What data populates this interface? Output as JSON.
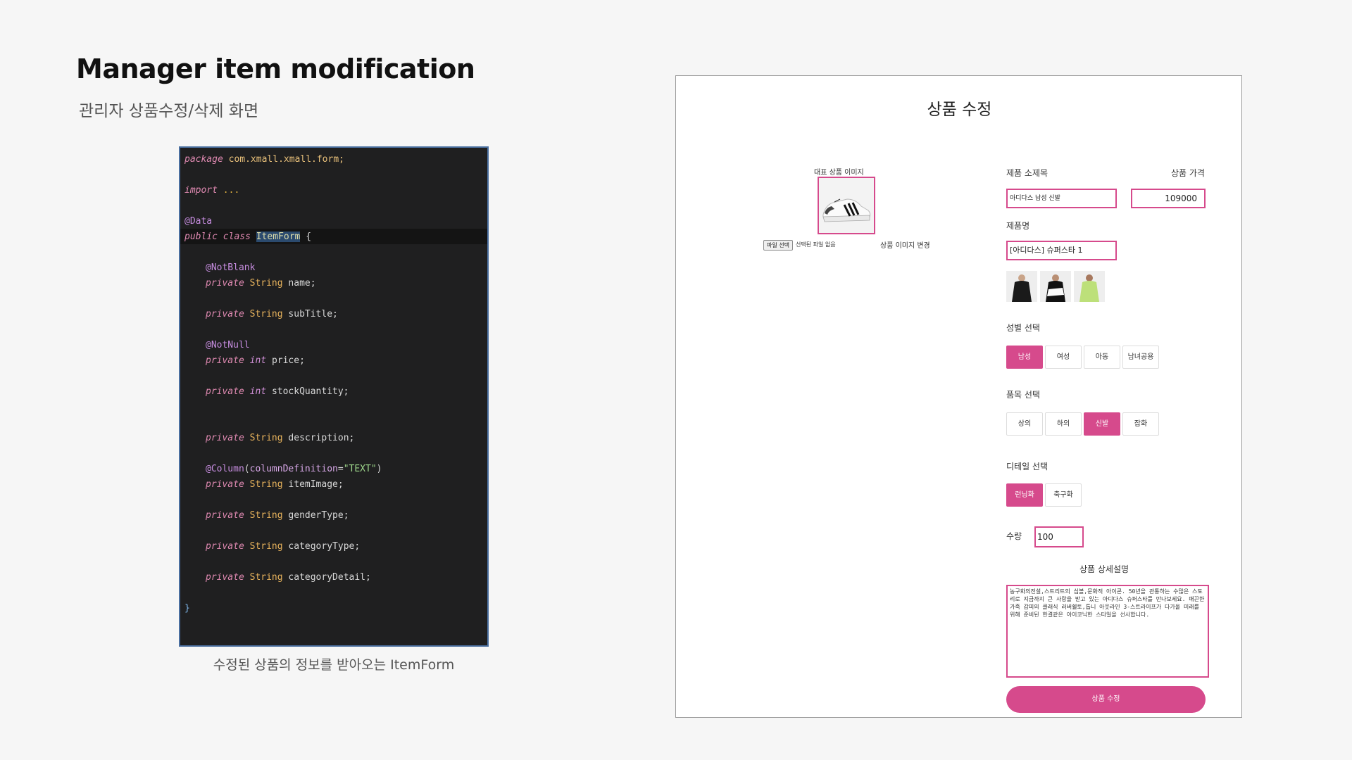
{
  "slide": {
    "title": "Manager item modification",
    "subtitle": "관리자 상품수정/삭제 화면",
    "code_caption": "수정된 상품의 정보를 받아오는 ItemForm"
  },
  "code": {
    "package_kw": "package",
    "package_name": "com.xmall.xmall.form;",
    "import_kw": "import",
    "import_rest": " ...",
    "data_annotation": "@Data",
    "public_kw": "public",
    "class_kw": "class",
    "class_name": "ItemForm",
    "open_brace": " {",
    "notblank": "@NotBlank",
    "notnull": "@NotNull",
    "column_anno": "@Column",
    "column_attr": "columnDefinition",
    "column_value": "\"TEXT\"",
    "private_kw": "private",
    "string_type": "String",
    "int_type": "int",
    "field_name": "name;",
    "field_subtitle": "subTitle;",
    "field_price": "price;",
    "field_stock": "stockQuantity;",
    "field_description": "description;",
    "field_itemimage": "itemImage;",
    "field_gender": "genderType;",
    "field_category": "categoryType;",
    "field_detail": "categoryDetail;",
    "close_brace": "}"
  },
  "form": {
    "title": "상품 수정",
    "main_image_label": "대표 상품 이미지",
    "file_button": "파일 선택",
    "file_status": "선택된 파일 없음",
    "change_image_label": "상품 이미지 변경",
    "subtitle_label": "제품 소제목",
    "subtitle_value": "아디다스 남성 신발",
    "price_label": "상품 가격",
    "price_value": "109000",
    "name_label": "제품명",
    "name_value": "[아디다스] 슈퍼스타 1",
    "gender_label": "성별 선택",
    "gender_options": [
      "남성",
      "여성",
      "아동",
      "남녀공용"
    ],
    "category_label": "품목 선택",
    "category_options": [
      "상의",
      "하의",
      "신발",
      "잡화"
    ],
    "detail_label": "디테일 선택",
    "detail_options": [
      "런닝화",
      "축구화"
    ],
    "quantity_label": "수량",
    "quantity_value": "100",
    "description_label": "상품 상세설명",
    "description_value": "농구화의전설,스트리트의 심볼,문화적 아이콘. 50년을 관통하는 수많은 스토리로 지금까지 큰 사랑을 받고 있는 아디다스 슈퍼스타를 만나보세요. 매끈한 가죽 갑피의 클래식 러버쉘토,톱니 아웃라인 3-스트라이프가 다가올 미래를 위해 준비된 한결같은 아이코닉한 스타일을 선사합니다.",
    "submit_label": "상품 수정"
  },
  "colors": {
    "accent": "#d64a8c",
    "code_bg": "#1f1f20",
    "slide_bg": "#f6f6f6"
  }
}
